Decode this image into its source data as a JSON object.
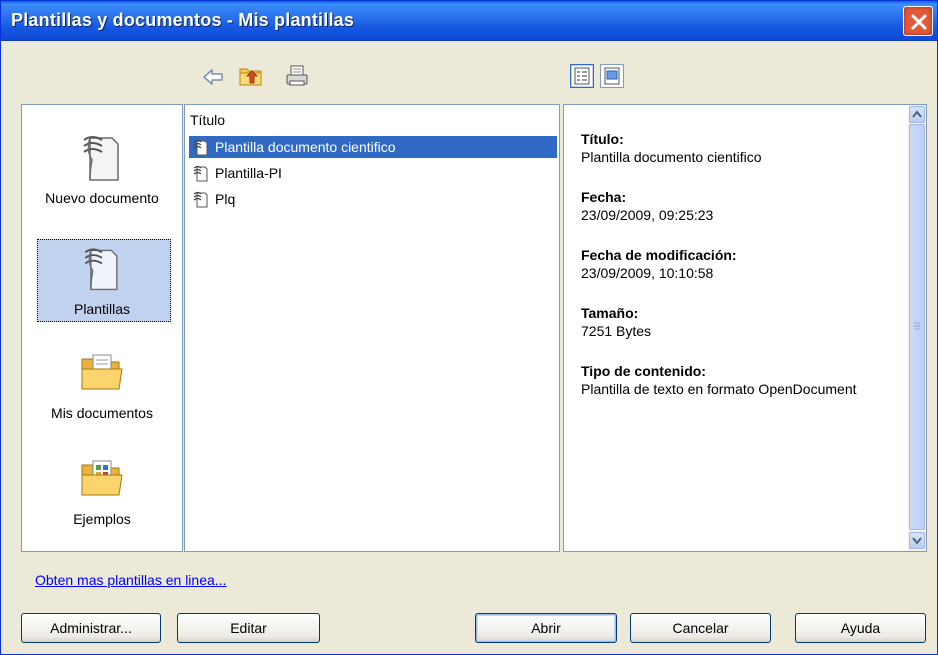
{
  "window": {
    "title": "Plantillas y documentos - Mis plantillas"
  },
  "categories": [
    {
      "label": "Nuevo documento",
      "accesskey": "N"
    },
    {
      "label": "Plantillas",
      "accesskey": "P"
    },
    {
      "label": "Mis documentos",
      "accesskey": "M"
    },
    {
      "label": "Ejemplos",
      "accesskey": "E"
    }
  ],
  "list": {
    "header": "Título",
    "items": [
      {
        "label": "Plantilla documento cientifico",
        "selected": true
      },
      {
        "label": "Plantilla-PI",
        "selected": false
      },
      {
        "label": "Plq",
        "selected": false
      }
    ]
  },
  "details": {
    "titulo_label": "Título:",
    "titulo_value": "Plantilla documento cientifico",
    "fecha_label": "Fecha:",
    "fecha_value": "23/09/2009, 09:25:23",
    "fecha_mod_label": "Fecha de modificación:",
    "fecha_mod_value": "23/09/2009, 10:10:58",
    "tamano_label": "Tamaño:",
    "tamano_value": "7251 Bytes",
    "tipo_label": "Tipo de contenido:",
    "tipo_value": "Plantilla de texto en formato OpenDocument"
  },
  "link": {
    "label": "Obten mas plantillas en linea..."
  },
  "buttons": {
    "administrar": "Administrar...",
    "editar": "Editar",
    "abrir": "Abrir",
    "cancelar": "Cancelar",
    "ayuda": "Ayuda"
  },
  "icons": {
    "back": "back-arrow-icon",
    "up": "folder-up-icon",
    "print": "print-icon",
    "doc_properties": "document-properties-icon",
    "preview": "preview-icon"
  },
  "colors": {
    "titlebar": "#2a72ee",
    "selection": "#316ac5",
    "dialog_bg": "#ece9d8",
    "link": "#0000ff"
  }
}
